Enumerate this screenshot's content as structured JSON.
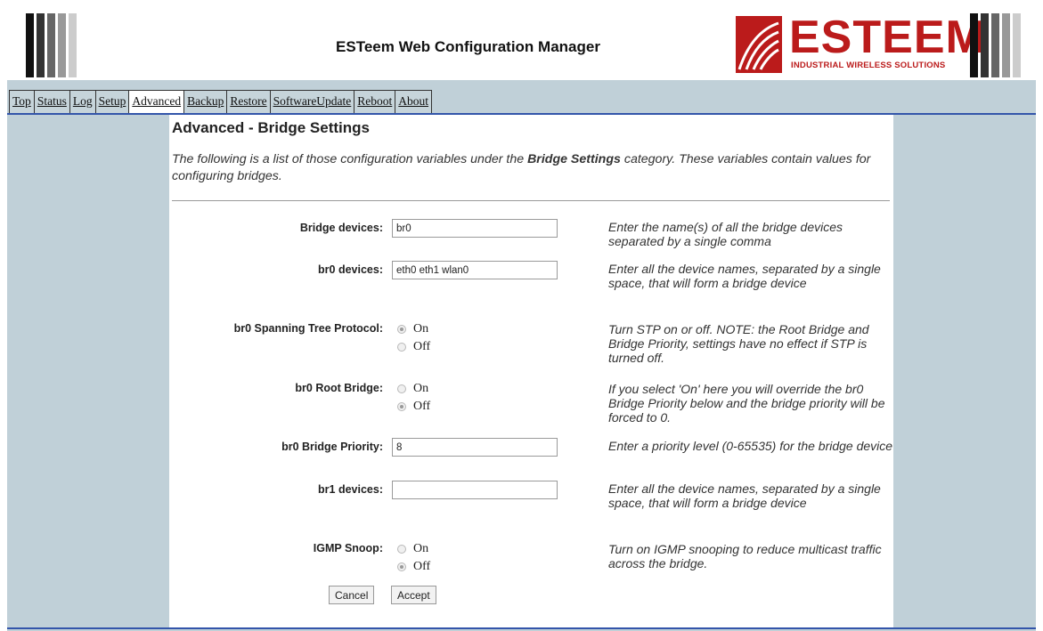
{
  "header": {
    "title": "ESTeem Web Configuration Manager",
    "logo_word": "ESTEEM",
    "logo_tagline": "INDUSTRIAL WIRELESS SOLUTIONS",
    "bar_colors": [
      "#111111",
      "#444444",
      "#777777",
      "#aaaaaa",
      "#dddddd"
    ]
  },
  "tabs": [
    {
      "label": "Top"
    },
    {
      "label": "Status"
    },
    {
      "label": "Log"
    },
    {
      "label": "Setup"
    },
    {
      "label": "Advanced",
      "active": true
    },
    {
      "label": "Backup"
    },
    {
      "label": "Restore"
    },
    {
      "label": "SoftwareUpdate"
    },
    {
      "label": "Reboot"
    },
    {
      "label": "About"
    }
  ],
  "page": {
    "title": "Advanced - Bridge Settings",
    "intro_before": "The following is a list of those configuration variables under the ",
    "intro_bold": "Bridge Settings",
    "intro_after": " category. These variables contain values for configuring bridges."
  },
  "fields": {
    "bridge_devices": {
      "label": "Bridge devices:",
      "value": "br0",
      "help": "Enter the name(s) of all the bridge devices separated by a single comma"
    },
    "br0_devices": {
      "label": "br0 devices:",
      "value": "eth0 eth1 wlan0",
      "help": "Enter all the device names, separated by a single space, that will form a bridge device"
    },
    "br0_stp": {
      "label": "br0 Spanning Tree Protocol:",
      "on_label": "On",
      "off_label": "Off",
      "selected": "On",
      "help": "Turn STP on or off. NOTE: the Root Bridge and Bridge Priority, settings have no effect if STP is turned off."
    },
    "br0_root_bridge": {
      "label": "br0 Root Bridge:",
      "on_label": "On",
      "off_label": "Off",
      "selected": "Off",
      "help": "If you select 'On' here you will override the br0 Bridge Priority below and the bridge priority will be forced to 0."
    },
    "br0_bridge_priority": {
      "label": "br0 Bridge Priority:",
      "value": "8",
      "help": "Enter a priority level (0-65535) for the bridge device"
    },
    "br1_devices": {
      "label": "br1 devices:",
      "value": "",
      "help": "Enter all the device names, separated by a single space, that will form a bridge device"
    },
    "igmp_snoop": {
      "label": "IGMP Snoop:",
      "on_label": "On",
      "off_label": "Off",
      "selected": "Off",
      "help": "Turn on IGMP snooping to reduce multicast traffic across the bridge."
    }
  },
  "buttons": {
    "cancel": "Cancel",
    "accept": "Accept"
  },
  "colors": {
    "frame_bg": "#c0d0d8",
    "accent_line": "#3355aa",
    "brand_red": "#bb1b1b"
  }
}
